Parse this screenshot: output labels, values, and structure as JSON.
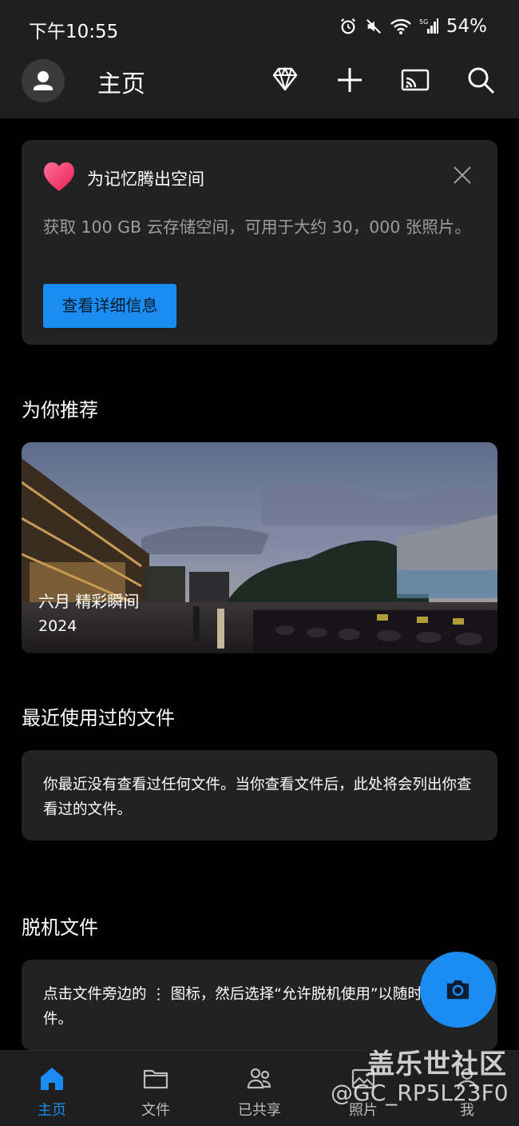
{
  "status_bar": {
    "time": "下午10:55",
    "battery": "54%",
    "network": "5G",
    "icons": [
      "alarm-icon",
      "mute-icon",
      "wifi-icon",
      "signal-icon"
    ]
  },
  "header": {
    "title": "主页",
    "icons": [
      "avatar-icon",
      "premium-diamond-icon",
      "add-icon",
      "cast-icon",
      "search-icon"
    ]
  },
  "promo": {
    "title": "为记忆腾出空间",
    "description": "获取 100 GB 云存储空间，可用于大约 30，000 张照片。",
    "button": "查看详细信息",
    "icon": "heart-icon"
  },
  "recommended": {
    "section_title": "为你推荐",
    "card_title": "六月 精彩瞬间",
    "card_year": "2024"
  },
  "recent": {
    "section_title": "最近使用过的文件",
    "empty_text": "你最近没有查看过任何文件。当你查看文件后，此处将会列出你查看过的文件。"
  },
  "offline": {
    "section_title": "脱机文件",
    "hint_text": "点击文件旁边的 ⋮ 图标，然后选择“允许脱机使用”以随时查看文件。"
  },
  "fab": {
    "icon": "camera-icon"
  },
  "bottom_nav": {
    "items": [
      {
        "label": "主页",
        "icon": "home-icon",
        "active": true
      },
      {
        "label": "文件",
        "icon": "folder-icon",
        "active": false
      },
      {
        "label": "已共享",
        "icon": "shared-people-icon",
        "active": false
      },
      {
        "label": "照片",
        "icon": "photo-icon",
        "active": false
      },
      {
        "label": "我",
        "icon": "me-icon",
        "active": false
      }
    ]
  },
  "watermark": {
    "main": "盖乐世社区",
    "sub": "@GC_RP5L23F0"
  },
  "colors": {
    "accent": "#1a8cf2",
    "card_bg": "#222222",
    "bar_bg": "#1f1f1f",
    "page_bg": "#000000"
  }
}
